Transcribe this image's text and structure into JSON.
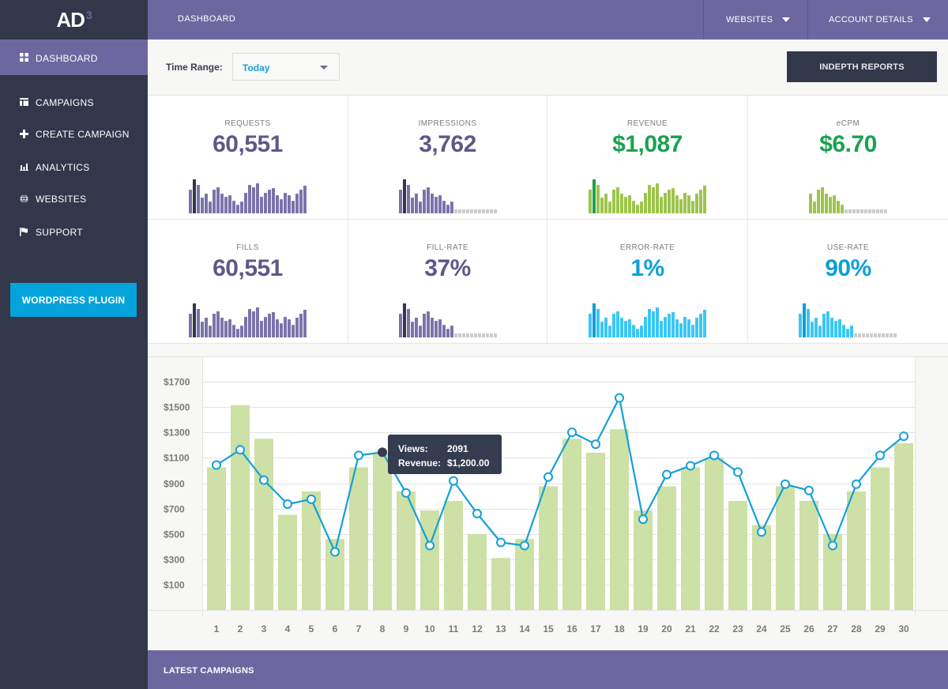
{
  "app": {
    "logo_text": "AD",
    "logo_sup": "3"
  },
  "topbar": {
    "title": "DASHBOARD",
    "menus": [
      {
        "label": "WEBSITES",
        "icon": "caret-down-icon"
      },
      {
        "label": "ACCOUNT DETAILS",
        "icon": "caret-down-icon"
      }
    ]
  },
  "sidebar": {
    "items": [
      {
        "label": "DASHBOARD",
        "icon": "grid-icon",
        "active": true
      },
      {
        "label": "CAMPAIGNS",
        "icon": "layout-icon"
      },
      {
        "label": "CREATE CAMPAIGN",
        "icon": "plus-icon"
      },
      {
        "label": "ANALYTICS",
        "icon": "bar-chart-icon"
      },
      {
        "label": "WEBSITES",
        "icon": "globe-icon"
      },
      {
        "label": "SUPPORT",
        "icon": "flag-icon"
      }
    ],
    "plugin_button": "WORDPRESS PLUGIN"
  },
  "toolbar": {
    "time_range_label": "Time Range:",
    "time_range_value": "Today",
    "reports_button": "INDEPTH REPORTS"
  },
  "colors": {
    "purple": "#6d67a0",
    "purple_text": "#5e5889",
    "dark": "#32374a",
    "green_text": "#1aa24f",
    "blue_text": "#0d9fd8",
    "spark_purple": "#7b73aa",
    "spark_green": "#9dc44c",
    "spark_green_hi": "#1ea14d",
    "spark_blue": "#3cc6f5",
    "spark_blue_hi": "#0b9fd6",
    "spark_empty": "#cccccc",
    "bar_green": "#cde0a6",
    "line_blue": "#14a0d8"
  },
  "stats": [
    {
      "name": "REQUESTS",
      "value": "60,551",
      "theme": "purple",
      "spark": [
        89,
        128,
        107,
        59,
        74,
        44,
        89,
        98,
        74,
        62,
        68,
        47,
        32,
        44,
        77,
        107,
        98,
        113,
        62,
        77,
        89,
        95,
        68,
        53,
        77,
        68,
        47,
        74,
        89,
        104
      ],
      "highlight": 1,
      "empty": 0
    },
    {
      "name": "IMPRESSIONS",
      "value": "3,762",
      "theme": "purple",
      "spark": [
        89,
        128,
        107,
        59,
        74,
        44,
        89,
        98,
        74,
        62,
        68,
        47,
        32,
        44
      ],
      "highlight": 1,
      "empty": 11
    },
    {
      "name": "REVENUE",
      "value": "$1,087",
      "theme": "green",
      "spark": [
        89,
        128,
        107,
        59,
        74,
        44,
        89,
        98,
        74,
        62,
        68,
        47,
        32,
        44,
        77,
        107,
        98,
        113,
        62,
        77,
        89,
        95,
        68,
        53,
        77,
        68,
        47,
        74,
        89,
        104
      ],
      "highlight": 1,
      "empty": 0
    },
    {
      "name": "eCPM",
      "value": "$6.70",
      "theme": "green",
      "spark": [
        74,
        44,
        89,
        98,
        74,
        62,
        68,
        47,
        32
      ],
      "highlight": -1,
      "empty": 11
    },
    {
      "name": "FILLS",
      "value": "60,551",
      "theme": "purple",
      "spark": [
        89,
        128,
        107,
        59,
        74,
        44,
        89,
        98,
        74,
        62,
        68,
        47,
        32,
        44,
        77,
        107,
        98,
        113,
        62,
        77,
        89,
        95,
        68,
        53,
        77,
        68,
        47,
        74,
        89,
        104
      ],
      "highlight": 1,
      "empty": 0
    },
    {
      "name": "FILL-RATE",
      "value": "37%",
      "theme": "purple",
      "spark": [
        89,
        128,
        107,
        59,
        74,
        44,
        89,
        98,
        74,
        62,
        68,
        47,
        32,
        44
      ],
      "highlight": 1,
      "empty": 11
    },
    {
      "name": "ERROR-RATE",
      "value": "1%",
      "theme": "blue",
      "spark": [
        89,
        128,
        107,
        59,
        74,
        44,
        89,
        98,
        74,
        62,
        68,
        47,
        32,
        44,
        77,
        107,
        98,
        113,
        62,
        77,
        89,
        95,
        68,
        53,
        77,
        68,
        47,
        74,
        89,
        104
      ],
      "highlight": 1,
      "empty": 0
    },
    {
      "name": "USE-RATE",
      "value": "90%",
      "theme": "blue",
      "spark": [
        89,
        128,
        107,
        59,
        74,
        44,
        89,
        98,
        74,
        62,
        68,
        47,
        32,
        44
      ],
      "highlight": 1,
      "empty": 11
    }
  ],
  "chart_data": {
    "type": "bar+line",
    "title": "",
    "xlabel": "",
    "ylabel": "",
    "categories": [
      "1",
      "2",
      "3",
      "4",
      "5",
      "6",
      "7",
      "8",
      "9",
      "10",
      "11",
      "12",
      "13",
      "14",
      "15",
      "16",
      "17",
      "18",
      "19",
      "20",
      "21",
      "22",
      "23",
      "24",
      "25",
      "26",
      "27",
      "28",
      "29",
      "30"
    ],
    "yticks": [
      100,
      300,
      500,
      700,
      900,
      1100,
      1300,
      1500,
      1700
    ],
    "ytick_labels": [
      "$100",
      "$300",
      "$500",
      "$700",
      "$900",
      "$1100",
      "$1300",
      "$1500",
      "$1700"
    ],
    "ylim": [
      -100,
      1900
    ],
    "grid": true,
    "series": [
      {
        "name": "Bars",
        "type": "bar",
        "values": [
          1025,
          1515,
          1250,
          650,
          835,
          460,
          1025,
          1140,
          835,
          685,
          760,
          500,
          310,
          460,
          875,
          1250,
          1140,
          1325,
          685,
          875,
          1025,
          1100,
          760,
          570,
          875,
          760,
          500,
          835,
          1025,
          1215
        ]
      },
      {
        "name": "Line",
        "type": "line",
        "values": [
          1043,
          1163,
          924,
          735,
          773,
          358,
          1119,
          1144,
          823,
          408,
          918,
          660,
          433,
          408,
          949,
          1301,
          1207,
          1572,
          616,
          968,
          1037,
          1119,
          987,
          515,
          892,
          842,
          408,
          892,
          1119,
          1270
        ]
      }
    ],
    "highlighted_index": 7,
    "tooltip": {
      "views_label": "Views:",
      "views_value": "2091",
      "revenue_label": "Revenue:",
      "revenue_value": "$1,200.00"
    }
  },
  "latest": {
    "label": "LATEST CAMPAIGNS"
  }
}
